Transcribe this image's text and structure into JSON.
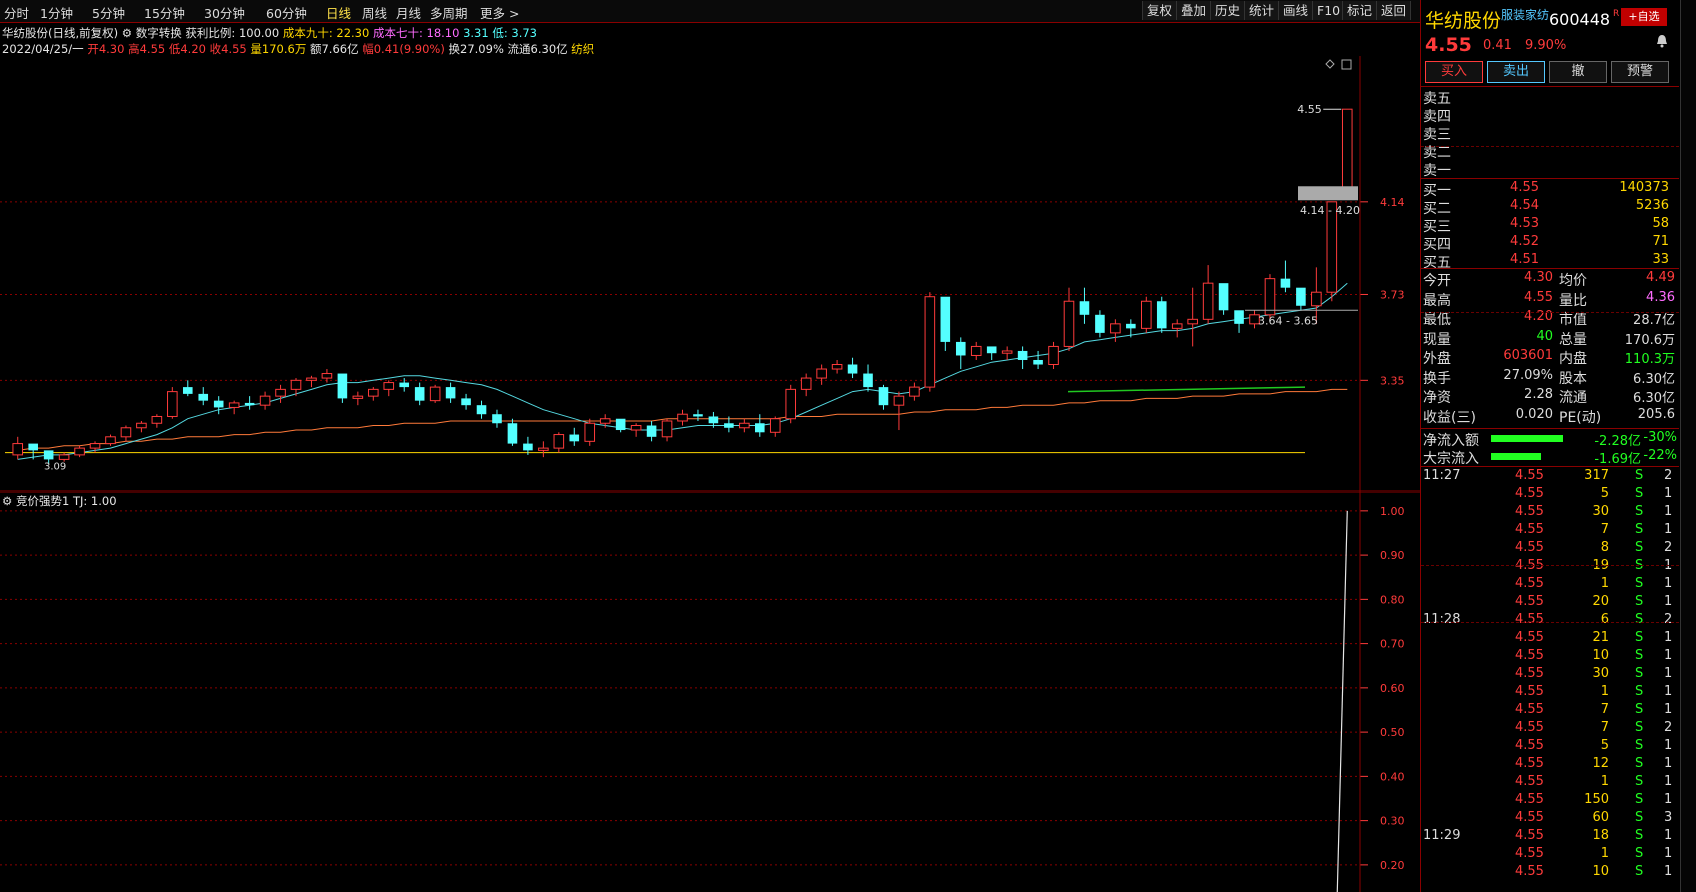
{
  "toolbar": {
    "timeframes": [
      "分时",
      "1分钟",
      "5分钟",
      "15分钟",
      "30分钟",
      "60分钟",
      "日线",
      "周线",
      "月线",
      "多周期",
      "更多 >"
    ],
    "active_timeframe": "日线",
    "buttons": [
      "复权",
      "叠加",
      "历史",
      "统计",
      "画线",
      "F10",
      "标记",
      "返回"
    ]
  },
  "chart_header": {
    "title": "华纺股份(日线,前复权)",
    "indicator": "数字转换",
    "profit_ratio": "获利比例: 100.00",
    "cost90": "成本九十: 22.30",
    "cost70": "成本七十: 18.10",
    "val2": "3.31",
    "low": "低: 3.73",
    "date": "2022/04/25/一",
    "open": "开4.30",
    "high": "高4.55",
    "low2": "低4.20",
    "close": "收4.55",
    "volume": "量170.6万",
    "amount": "额7.66亿",
    "change": "幅0.41(9.90%)",
    "turnover": "换27.09%",
    "float": "流通6.30亿",
    "industry": "纺织"
  },
  "chart_data": {
    "type": "candlestick",
    "ylim": [
      2.9,
      4.75
    ],
    "y_ticks": [
      "4.14",
      "3.73",
      "3.35"
    ],
    "annotations": {
      "high_label": "4.55",
      "range1": "4.14 - 4.20",
      "range2": "3.64 - 3.65",
      "low_label": "3.09"
    },
    "candles": [
      [
        3.02,
        3.1,
        3.0,
        3.07
      ],
      [
        3.07,
        3.05,
        3.0,
        3.04
      ],
      [
        3.04,
        3.02,
        2.98,
        3.0
      ],
      [
        3.0,
        3.03,
        2.99,
        3.02
      ],
      [
        3.02,
        3.06,
        3.01,
        3.05
      ],
      [
        3.05,
        3.08,
        3.03,
        3.07
      ],
      [
        3.07,
        3.11,
        3.06,
        3.1
      ],
      [
        3.1,
        3.15,
        3.08,
        3.14
      ],
      [
        3.14,
        3.17,
        3.12,
        3.16
      ],
      [
        3.16,
        3.2,
        3.14,
        3.19
      ],
      [
        3.19,
        3.32,
        3.18,
        3.3
      ],
      [
        3.32,
        3.35,
        3.28,
        3.29
      ],
      [
        3.29,
        3.32,
        3.24,
        3.26
      ],
      [
        3.26,
        3.28,
        3.2,
        3.23
      ],
      [
        3.23,
        3.26,
        3.2,
        3.25
      ],
      [
        3.25,
        3.28,
        3.22,
        3.24
      ],
      [
        3.24,
        3.3,
        3.22,
        3.28
      ],
      [
        3.28,
        3.33,
        3.25,
        3.31
      ],
      [
        3.31,
        3.36,
        3.28,
        3.35
      ],
      [
        3.35,
        3.37,
        3.32,
        3.36
      ],
      [
        3.36,
        3.4,
        3.34,
        3.38
      ],
      [
        3.38,
        3.36,
        3.25,
        3.27
      ],
      [
        3.27,
        3.3,
        3.24,
        3.28
      ],
      [
        3.28,
        3.32,
        3.26,
        3.31
      ],
      [
        3.31,
        3.35,
        3.28,
        3.34
      ],
      [
        3.34,
        3.36,
        3.3,
        3.32
      ],
      [
        3.32,
        3.34,
        3.24,
        3.26
      ],
      [
        3.26,
        3.33,
        3.25,
        3.32
      ],
      [
        3.32,
        3.34,
        3.25,
        3.27
      ],
      [
        3.27,
        3.29,
        3.22,
        3.24
      ],
      [
        3.24,
        3.26,
        3.18,
        3.2
      ],
      [
        3.2,
        3.22,
        3.14,
        3.16
      ],
      [
        3.16,
        3.18,
        3.06,
        3.07
      ],
      [
        3.07,
        3.1,
        3.02,
        3.04
      ],
      [
        3.04,
        3.08,
        3.01,
        3.05
      ],
      [
        3.05,
        3.12,
        3.03,
        3.11
      ],
      [
        3.11,
        3.14,
        3.06,
        3.08
      ],
      [
        3.08,
        3.18,
        3.06,
        3.16
      ],
      [
        3.16,
        3.2,
        3.14,
        3.18
      ],
      [
        3.18,
        3.17,
        3.12,
        3.13
      ],
      [
        3.13,
        3.16,
        3.1,
        3.15
      ],
      [
        3.15,
        3.17,
        3.08,
        3.1
      ],
      [
        3.1,
        3.18,
        3.08,
        3.17
      ],
      [
        3.17,
        3.22,
        3.15,
        3.2
      ],
      [
        3.2,
        3.22,
        3.17,
        3.19
      ],
      [
        3.19,
        3.21,
        3.14,
        3.16
      ],
      [
        3.16,
        3.19,
        3.12,
        3.14
      ],
      [
        3.14,
        3.18,
        3.12,
        3.16
      ],
      [
        3.16,
        3.2,
        3.1,
        3.12
      ],
      [
        3.12,
        3.19,
        3.1,
        3.18
      ],
      [
        3.18,
        3.33,
        3.16,
        3.31
      ],
      [
        3.31,
        3.38,
        3.28,
        3.36
      ],
      [
        3.36,
        3.42,
        3.33,
        3.4
      ],
      [
        3.4,
        3.44,
        3.38,
        3.42
      ],
      [
        3.42,
        3.45,
        3.36,
        3.38
      ],
      [
        3.38,
        3.42,
        3.3,
        3.32
      ],
      [
        3.32,
        3.33,
        3.22,
        3.24
      ],
      [
        3.24,
        3.3,
        3.13,
        3.28
      ],
      [
        3.28,
        3.34,
        3.26,
        3.32
      ],
      [
        3.32,
        3.74,
        3.3,
        3.72
      ],
      [
        3.72,
        3.7,
        3.48,
        3.52
      ],
      [
        3.52,
        3.54,
        3.4,
        3.46
      ],
      [
        3.46,
        3.52,
        3.44,
        3.5
      ],
      [
        3.5,
        3.48,
        3.44,
        3.47
      ],
      [
        3.47,
        3.5,
        3.44,
        3.48
      ],
      [
        3.48,
        3.5,
        3.4,
        3.44
      ],
      [
        3.44,
        3.48,
        3.4,
        3.42
      ],
      [
        3.42,
        3.52,
        3.4,
        3.5
      ],
      [
        3.5,
        3.76,
        3.48,
        3.7
      ],
      [
        3.7,
        3.76,
        3.6,
        3.64
      ],
      [
        3.64,
        3.66,
        3.54,
        3.56
      ],
      [
        3.56,
        3.62,
        3.52,
        3.6
      ],
      [
        3.6,
        3.62,
        3.54,
        3.58
      ],
      [
        3.58,
        3.72,
        3.56,
        3.7
      ],
      [
        3.7,
        3.72,
        3.56,
        3.58
      ],
      [
        3.58,
        3.62,
        3.54,
        3.6
      ],
      [
        3.6,
        3.76,
        3.5,
        3.62
      ],
      [
        3.62,
        3.86,
        3.6,
        3.78
      ],
      [
        3.78,
        3.76,
        3.64,
        3.66
      ],
      [
        3.66,
        3.62,
        3.56,
        3.6
      ],
      [
        3.6,
        3.66,
        3.58,
        3.64
      ],
      [
        3.64,
        3.82,
        3.62,
        3.8
      ],
      [
        3.8,
        3.88,
        3.74,
        3.76
      ],
      [
        3.76,
        3.74,
        3.66,
        3.68
      ],
      [
        3.68,
        3.85,
        3.6,
        3.74
      ],
      [
        3.74,
        4.14,
        3.7,
        4.14
      ],
      [
        4.2,
        4.55,
        4.2,
        4.55
      ]
    ],
    "ma_short": [
      3.0,
      3.01,
      3.02,
      3.02,
      3.03,
      3.04,
      3.05,
      3.07,
      3.09,
      3.11,
      3.14,
      3.18,
      3.2,
      3.22,
      3.23,
      3.24,
      3.25,
      3.27,
      3.29,
      3.31,
      3.33,
      3.34,
      3.34,
      3.35,
      3.36,
      3.37,
      3.37,
      3.36,
      3.35,
      3.34,
      3.33,
      3.31,
      3.28,
      3.25,
      3.22,
      3.2,
      3.18,
      3.16,
      3.15,
      3.14,
      3.13,
      3.13,
      3.13,
      3.14,
      3.15,
      3.15,
      3.15,
      3.15,
      3.15,
      3.16,
      3.18,
      3.21,
      3.24,
      3.27,
      3.3,
      3.31,
      3.3,
      3.29,
      3.3,
      3.33,
      3.36,
      3.39,
      3.41,
      3.43,
      3.44,
      3.45,
      3.46,
      3.47,
      3.49,
      3.52,
      3.53,
      3.54,
      3.55,
      3.56,
      3.57,
      3.57,
      3.58,
      3.6,
      3.61,
      3.62,
      3.63,
      3.64,
      3.65,
      3.66,
      3.67,
      3.72,
      3.78
    ],
    "ma_long": [
      3.04,
      3.05,
      3.05,
      3.06,
      3.06,
      3.07,
      3.07,
      3.08,
      3.08,
      3.09,
      3.09,
      3.1,
      3.1,
      3.1,
      3.11,
      3.11,
      3.12,
      3.12,
      3.13,
      3.13,
      3.14,
      3.14,
      3.14,
      3.15,
      3.15,
      3.16,
      3.16,
      3.16,
      3.17,
      3.17,
      3.17,
      3.17,
      3.17,
      3.17,
      3.17,
      3.17,
      3.17,
      3.17,
      3.17,
      3.17,
      3.17,
      3.17,
      3.18,
      3.18,
      3.18,
      3.18,
      3.18,
      3.18,
      3.18,
      3.18,
      3.19,
      3.19,
      3.19,
      3.2,
      3.2,
      3.2,
      3.2,
      3.2,
      3.21,
      3.21,
      3.22,
      3.22,
      3.22,
      3.23,
      3.23,
      3.24,
      3.24,
      3.24,
      3.25,
      3.25,
      3.26,
      3.26,
      3.26,
      3.27,
      3.27,
      3.27,
      3.28,
      3.28,
      3.28,
      3.29,
      3.29,
      3.29,
      3.3,
      3.3,
      3.3,
      3.31,
      3.31
    ],
    "sub_indicator": {
      "name": "竞价强势1",
      "value": "TJ: 1.00",
      "y_ticks": [
        "1.00",
        "0.90",
        "0.80",
        "0.70",
        "0.60",
        "0.50",
        "0.40",
        "0.30",
        "0.20"
      ],
      "ylim": [
        0.15,
        1.02
      ],
      "series": [
        0,
        0,
        0,
        0,
        0,
        0,
        0,
        0,
        0,
        0,
        0,
        0,
        0,
        0,
        0,
        0,
        0,
        0,
        0,
        0,
        0,
        0,
        0,
        0,
        0,
        0,
        0,
        0,
        0,
        0,
        0,
        0,
        0,
        0,
        0,
        0,
        0,
        0,
        0,
        0,
        0,
        0,
        0,
        0,
        0,
        0,
        0,
        0,
        0,
        0,
        0,
        0,
        0,
        0,
        0,
        0,
        0,
        0,
        0,
        0,
        0,
        0,
        0,
        0,
        0,
        0,
        0,
        0,
        0,
        0,
        0,
        0,
        0,
        0,
        0,
        0,
        0,
        0,
        0,
        0,
        0,
        0,
        0,
        0,
        0,
        0,
        1.0
      ]
    }
  },
  "quote": {
    "name": "华纺股份",
    "industry": "服装家纺",
    "code": "600448",
    "flag": "R",
    "add_fav": "+自选",
    "price": "4.55",
    "change": "0.41",
    "change_pct": "9.90%",
    "buttons": [
      "买入",
      "卖出",
      "撤",
      "预警"
    ],
    "asks": [
      {
        "label": "卖五",
        "price": "",
        "vol": ""
      },
      {
        "label": "卖四",
        "price": "",
        "vol": ""
      },
      {
        "label": "卖三",
        "price": "",
        "vol": ""
      },
      {
        "label": "卖二",
        "price": "",
        "vol": ""
      },
      {
        "label": "卖一",
        "price": "",
        "vol": ""
      }
    ],
    "bids": [
      {
        "label": "买一",
        "price": "4.55",
        "vol": "140373"
      },
      {
        "label": "买二",
        "price": "4.54",
        "vol": "5236"
      },
      {
        "label": "买三",
        "price": "4.53",
        "vol": "58"
      },
      {
        "label": "买四",
        "price": "4.52",
        "vol": "71"
      },
      {
        "label": "买五",
        "price": "4.51",
        "vol": "33"
      }
    ],
    "stats": [
      {
        "l1": "今开",
        "v1": "4.30",
        "l2": "均价",
        "v2": "4.49"
      },
      {
        "l1": "最高",
        "v1": "4.55",
        "l2": "量比",
        "v2": "4.36"
      },
      {
        "l1": "最低",
        "v1": "4.20",
        "l2": "市值",
        "v2": "28.7亿"
      },
      {
        "l1": "现量",
        "v1": "40",
        "l2": "总量",
        "v2": "170.6万"
      },
      {
        "l1": "外盘",
        "v1": "603601",
        "l2": "内盘",
        "v2": "110.3万"
      },
      {
        "l1": "换手",
        "v1": "27.09%",
        "l2": "股本",
        "v2": "6.30亿"
      },
      {
        "l1": "净资",
        "v1": "2.28",
        "l2": "流通",
        "v2": "6.30亿"
      },
      {
        "l1": "收益(三)",
        "v1": "0.020",
        "l2": "PE(动)",
        "v2": "205.6"
      }
    ],
    "flows": [
      {
        "label": "净流入额",
        "value": "-2.28亿",
        "pct": "-30%"
      },
      {
        "label": "大宗流入",
        "value": "-1.69亿",
        "pct": "-22%"
      }
    ],
    "trades": [
      {
        "time": "11:27",
        "price": "4.55",
        "vol": "317",
        "side": "S",
        "n": "2"
      },
      {
        "time": "",
        "price": "4.55",
        "vol": "5",
        "side": "S",
        "n": "1"
      },
      {
        "time": "",
        "price": "4.55",
        "vol": "30",
        "side": "S",
        "n": "1"
      },
      {
        "time": "",
        "price": "4.55",
        "vol": "7",
        "side": "S",
        "n": "1"
      },
      {
        "time": "",
        "price": "4.55",
        "vol": "8",
        "side": "S",
        "n": "2"
      },
      {
        "time": "",
        "price": "4.55",
        "vol": "19",
        "side": "S",
        "n": "1"
      },
      {
        "time": "",
        "price": "4.55",
        "vol": "1",
        "side": "S",
        "n": "1"
      },
      {
        "time": "",
        "price": "4.55",
        "vol": "20",
        "side": "S",
        "n": "1"
      },
      {
        "time": "11:28",
        "price": "4.55",
        "vol": "6",
        "side": "S",
        "n": "2"
      },
      {
        "time": "",
        "price": "4.55",
        "vol": "21",
        "side": "S",
        "n": "1"
      },
      {
        "time": "",
        "price": "4.55",
        "vol": "10",
        "side": "S",
        "n": "1"
      },
      {
        "time": "",
        "price": "4.55",
        "vol": "30",
        "side": "S",
        "n": "1"
      },
      {
        "time": "",
        "price": "4.55",
        "vol": "1",
        "side": "S",
        "n": "1"
      },
      {
        "time": "",
        "price": "4.55",
        "vol": "7",
        "side": "S",
        "n": "1"
      },
      {
        "time": "",
        "price": "4.55",
        "vol": "7",
        "side": "S",
        "n": "2"
      },
      {
        "time": "",
        "price": "4.55",
        "vol": "5",
        "side": "S",
        "n": "1"
      },
      {
        "time": "",
        "price": "4.55",
        "vol": "12",
        "side": "S",
        "n": "1"
      },
      {
        "time": "",
        "price": "4.55",
        "vol": "1",
        "side": "S",
        "n": "1"
      },
      {
        "time": "",
        "price": "4.55",
        "vol": "150",
        "side": "S",
        "n": "1"
      },
      {
        "time": "",
        "price": "4.55",
        "vol": "60",
        "side": "S",
        "n": "3"
      },
      {
        "time": "11:29",
        "price": "4.55",
        "vol": "18",
        "side": "S",
        "n": "1"
      },
      {
        "time": "",
        "price": "4.55",
        "vol": "1",
        "side": "S",
        "n": "1"
      },
      {
        "time": "",
        "price": "4.55",
        "vol": "10",
        "side": "S",
        "n": "1"
      }
    ]
  },
  "colors": {
    "up": "#ff3b3b",
    "down": "#54ffff",
    "ma_short": "#54d8e0",
    "ma_long": "#ff7a3a",
    "grid": "#8a0000",
    "highlight": "#ffd700"
  }
}
